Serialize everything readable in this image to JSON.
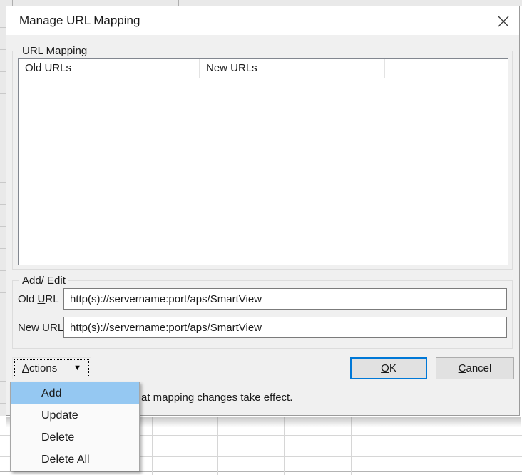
{
  "dialog": {
    "title": "Manage URL Mapping"
  },
  "url_mapping_group": {
    "label": "URL Mapping",
    "columns": [
      {
        "label": "Old URLs"
      },
      {
        "label": "New URLs"
      },
      {
        "label": ""
      }
    ],
    "rows": []
  },
  "add_edit_group": {
    "label": "Add/ Edit",
    "old_url": {
      "label_pre": "Old ",
      "label_mnemonic": "U",
      "label_rest": "RL",
      "value": "http(s)://servername:port/aps/SmartView"
    },
    "new_url": {
      "label_pre": "",
      "label_mnemonic": "N",
      "label_rest": "ew URL",
      "value": "http(s)://servername:port/aps/SmartView"
    }
  },
  "actions_button": {
    "label_mnemonic": "A",
    "label_rest": "ctions",
    "dropdown_icon": "▼"
  },
  "ok_button": {
    "label_mnemonic": "O",
    "label_rest": "K"
  },
  "cancel_button": {
    "label_mnemonic": "C",
    "label_rest": "ancel"
  },
  "note_text_visible": "at mapping changes take effect.",
  "menu": {
    "items": [
      {
        "label": "Add",
        "highlighted": true
      },
      {
        "label": "Update",
        "highlighted": false
      },
      {
        "label": "Delete",
        "highlighted": false
      },
      {
        "label": "Delete All",
        "highlighted": false
      }
    ]
  },
  "colors": {
    "accent_default_button_border": "#0078d7",
    "menu_highlight": "#95c8f2",
    "dialog_background": "#f0f0f0"
  }
}
